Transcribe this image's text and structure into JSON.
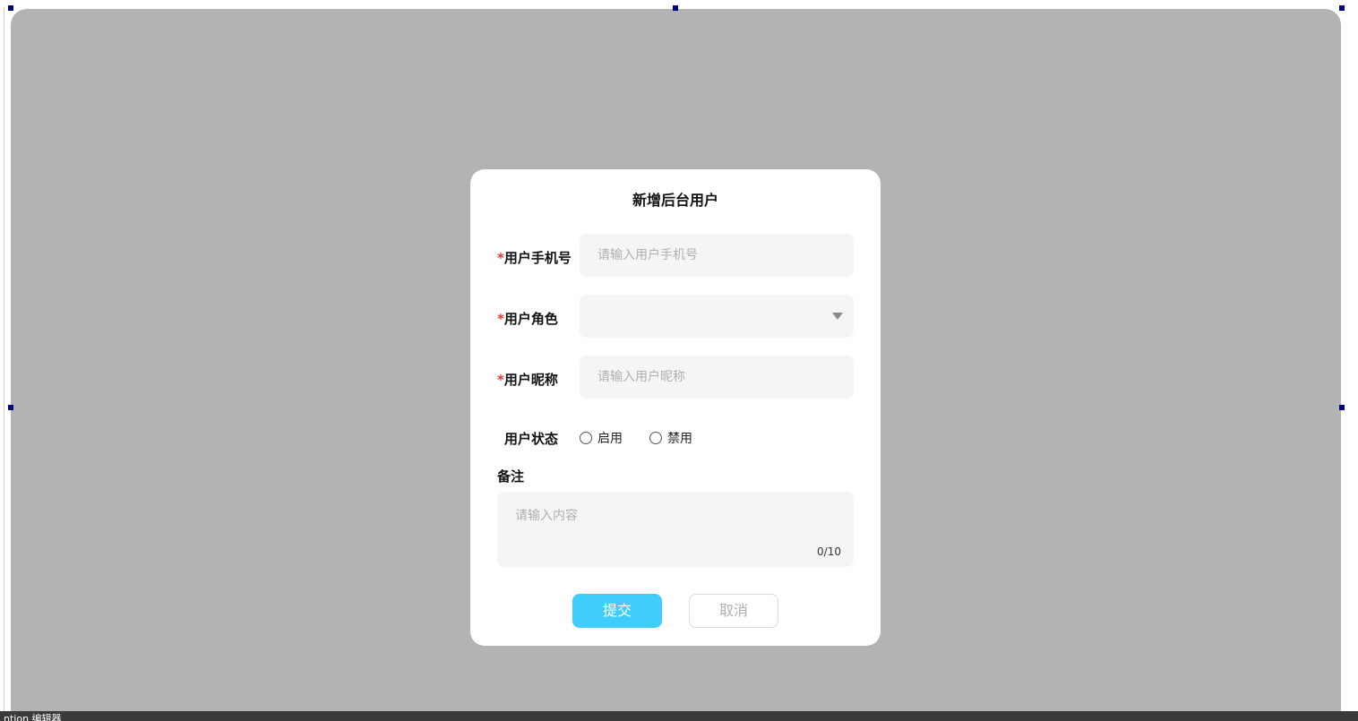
{
  "dialog": {
    "title": "新增后台用户"
  },
  "form": {
    "required_mark": "*",
    "phone": {
      "label": "用户手机号",
      "placeholder": "请输入用户手机号",
      "value": ""
    },
    "role": {
      "label": "用户角色",
      "value": ""
    },
    "nickname": {
      "label": "用户昵称",
      "placeholder": "请输入用户昵称",
      "value": ""
    },
    "status": {
      "label": "用户状态",
      "options": [
        "启用",
        "禁用"
      ]
    },
    "remark": {
      "label": "备注",
      "placeholder": "请输入内容",
      "counter": "0/10"
    }
  },
  "buttons": {
    "submit": "提交",
    "cancel": "取消"
  },
  "status_bar": {
    "text": "ntion 编辑器"
  },
  "colors": {
    "overlay": "#b3b3b3",
    "accent": "#40cdfc",
    "required": "#e53935",
    "input_bg": "#f5f5f5"
  }
}
